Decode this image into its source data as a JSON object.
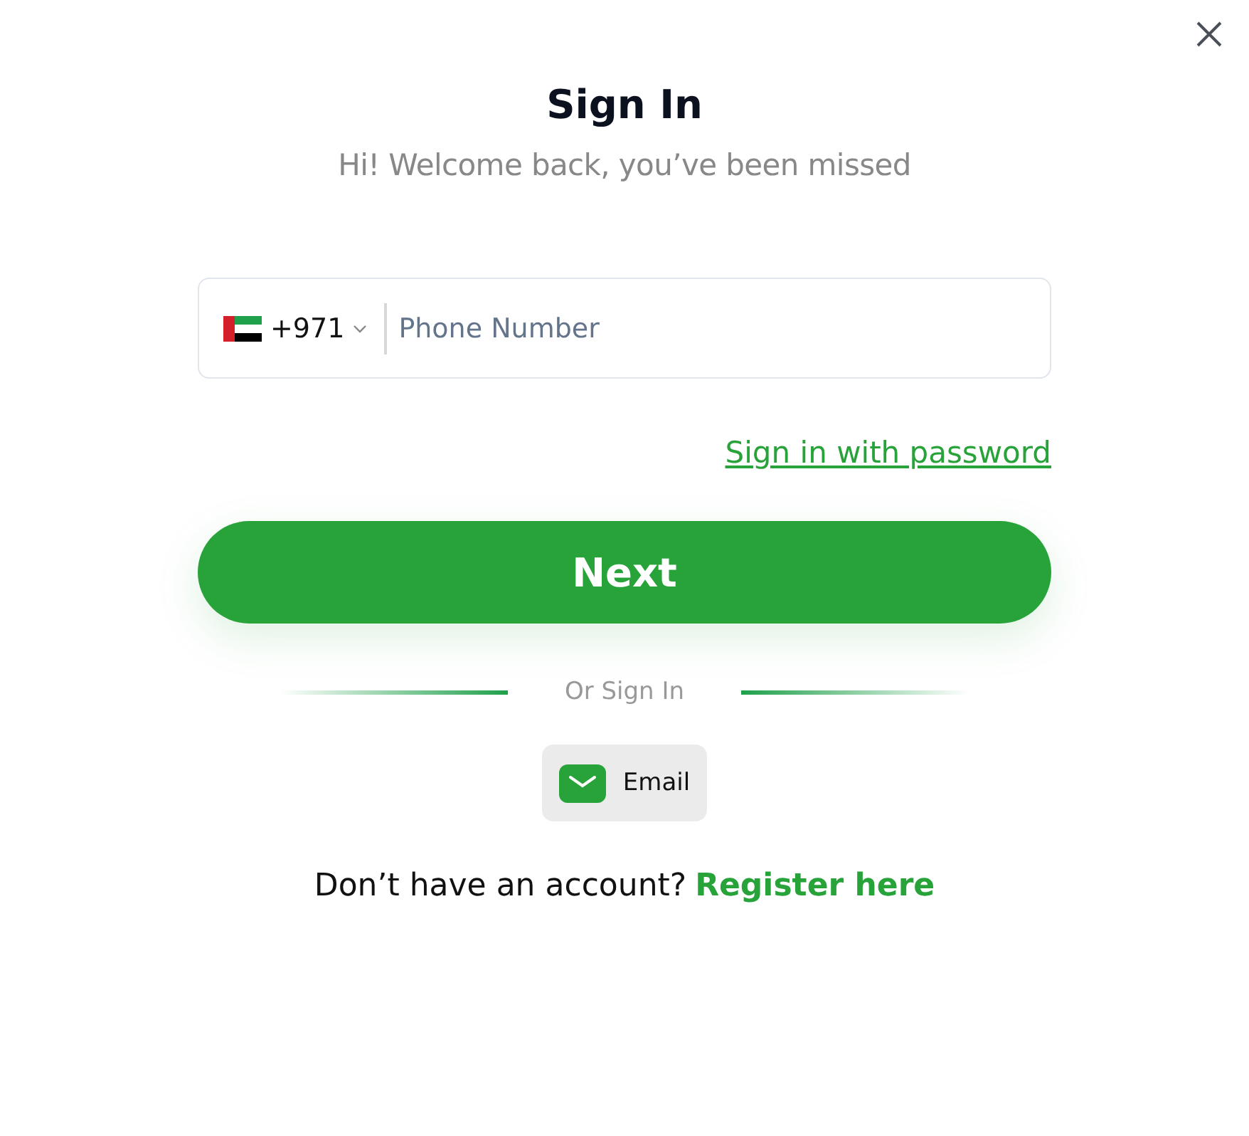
{
  "title": "Sign In",
  "subtitle": "Hi! Welcome back, you’ve been missed",
  "phone_field": {
    "country_code": "+971",
    "placeholder": "Phone Number"
  },
  "password_link": "Sign in with password",
  "next_button": "Next",
  "divider_text": "Or Sign In",
  "alt_methods": [
    {
      "kind": "email",
      "label": "Email"
    }
  ],
  "register": {
    "prompt": "Don’t have an account?",
    "link": "Register here"
  }
}
